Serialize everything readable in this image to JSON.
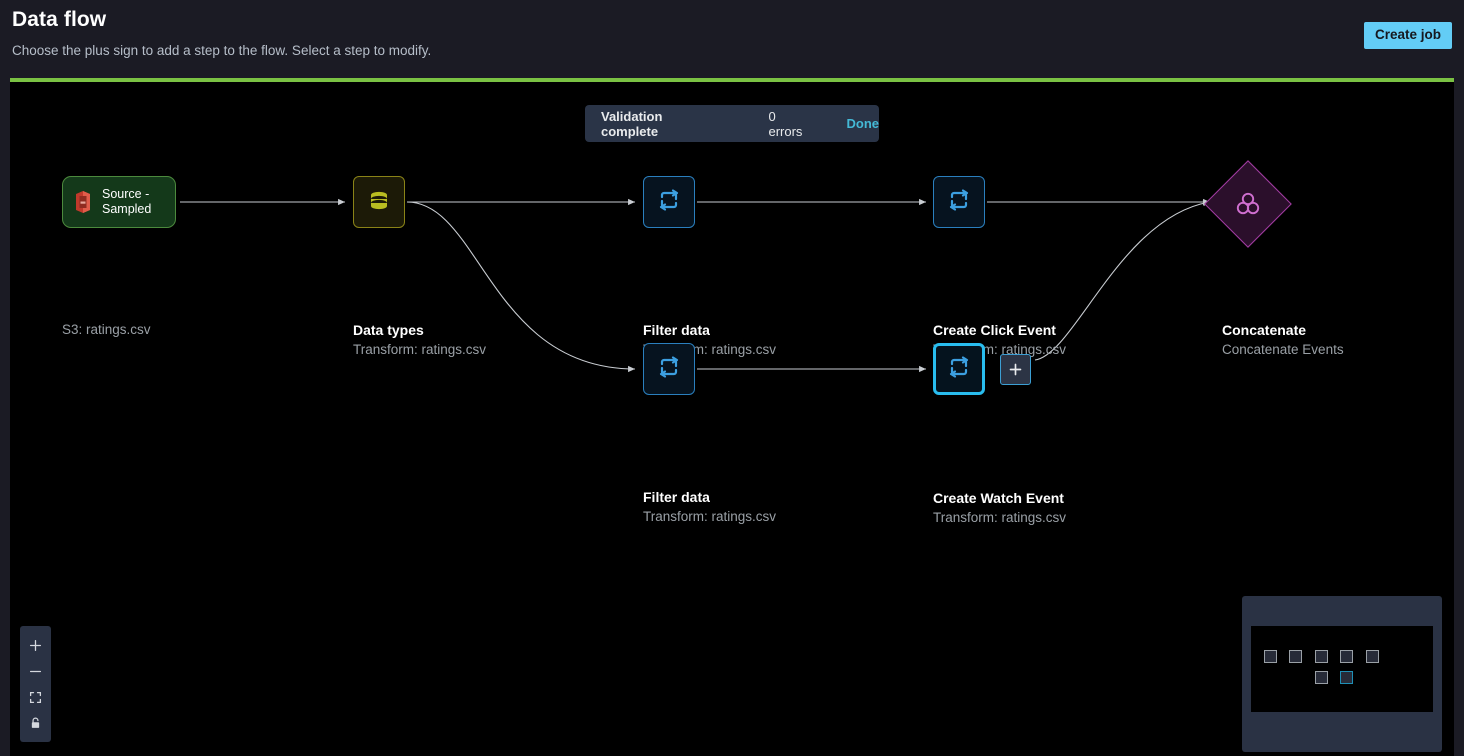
{
  "header": {
    "title": "Data flow",
    "subtitle": "Choose the plus sign to add a step to the flow. Select a step to modify.",
    "create_job_label": "Create job",
    "accent_color": "#7ac143"
  },
  "validation_banner": {
    "message": "Validation complete",
    "errors": "0 errors",
    "done_label": "Done",
    "done_color": "#44b9d6"
  },
  "canvas": {
    "nodes": [
      {
        "id": "source",
        "kind": "source",
        "inline_label": "Source -\nSampled",
        "inline_label_line1": "Source -",
        "inline_label_line2": "Sampled",
        "title": "",
        "subtitle": "S3: ratings.csv",
        "icon": "s3-bucket-icon",
        "accent": "#4c8a3d"
      },
      {
        "id": "data-types",
        "kind": "datatypes",
        "title": "Data types",
        "subtitle": "Transform: ratings.csv",
        "icon": "database-icon",
        "accent": "#8a8317"
      },
      {
        "id": "filter-data-top",
        "kind": "transform",
        "title": "Filter data",
        "subtitle": "Transform: ratings.csv",
        "icon": "transform-loop-icon",
        "accent": "#2a7fbe"
      },
      {
        "id": "create-click-event",
        "kind": "transform",
        "title": "Create Click Event",
        "subtitle": "Transform: ratings.csv",
        "icon": "transform-loop-icon",
        "accent": "#2a7fbe"
      },
      {
        "id": "concatenate",
        "kind": "concatenate",
        "title": "Concatenate",
        "subtitle": "Concatenate Events",
        "icon": "concatenate-icon",
        "accent": "#a23ca2"
      },
      {
        "id": "filter-data-bottom",
        "kind": "transform",
        "title": "Filter data",
        "subtitle": "Transform: ratings.csv",
        "icon": "transform-loop-icon",
        "accent": "#2a7fbe"
      },
      {
        "id": "create-watch-event",
        "kind": "transform-selected",
        "title": "Create Watch Event",
        "subtitle": "Transform: ratings.csv",
        "icon": "transform-loop-icon",
        "accent": "#29bdef",
        "selected": true
      }
    ],
    "add_step_button": {
      "icon": "plus-icon",
      "label": "+"
    }
  },
  "zoom_toolbar": {
    "buttons": [
      {
        "name": "zoom-in-button",
        "icon": "plus-icon",
        "glyph": "+"
      },
      {
        "name": "zoom-out-button",
        "icon": "minus-icon",
        "glyph": "−"
      },
      {
        "name": "fit-to-screen-button",
        "icon": "fit-screen-icon",
        "glyph": ""
      },
      {
        "name": "lock-canvas-button",
        "icon": "lock-icon",
        "glyph": ""
      }
    ]
  },
  "minimap": {
    "name": "canvas-minimap",
    "nodes": [
      {
        "selected": false
      },
      {
        "selected": false
      },
      {
        "selected": false
      },
      {
        "selected": false
      },
      {
        "selected": false
      },
      {
        "selected": false
      },
      {
        "selected": true
      }
    ]
  }
}
